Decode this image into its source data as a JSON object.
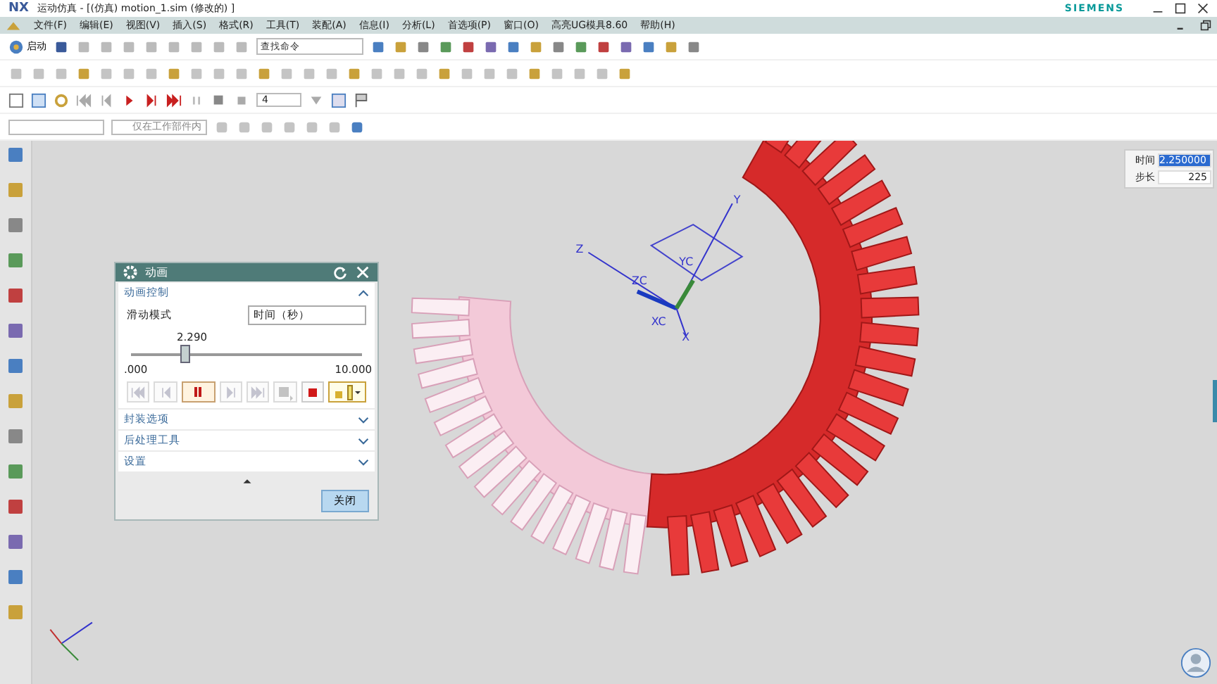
{
  "window": {
    "logo": "NX",
    "title": "运动仿真 - [(仿真) motion_1.sim  (修改的) ]",
    "brand": "SIEMENS"
  },
  "menu": [
    "文件(F)",
    "编辑(E)",
    "视图(V)",
    "插入(S)",
    "格式(R)",
    "工具(T)",
    "装配(A)",
    "信息(I)",
    "分析(L)",
    "首选项(P)",
    "窗口(O)",
    "高亮UG模具8.60",
    "帮助(H)"
  ],
  "toolbar": {
    "start_label": "启动",
    "search_placeholder": "查找命令",
    "step_value": "4",
    "scope_value": "仅在工作部件内"
  },
  "dialog": {
    "title": "动画",
    "mode_label": "滑动模式",
    "mode_value": "时间（秒）",
    "slider": {
      "reading": "2.290",
      "level": 0.229,
      "min": ".000",
      "max": "10.000"
    },
    "playback": [
      {
        "kind": "first",
        "disabled": true,
        "selected": false
      },
      {
        "kind": "prev",
        "disabled": true,
        "selected": false
      },
      {
        "kind": "pause",
        "disabled": false,
        "selected": true
      },
      {
        "kind": "next",
        "disabled": true,
        "selected": false
      },
      {
        "kind": "last",
        "disabled": true,
        "selected": false
      },
      {
        "kind": "export",
        "disabled": true,
        "selected": false
      },
      {
        "kind": "stop",
        "disabled": false,
        "selected": false
      },
      {
        "kind": "trace",
        "disabled": false,
        "selected": false
      }
    ],
    "sections": [
      {
        "label": "动画控制",
        "expanded": true
      },
      {
        "label": "封装选项",
        "expanded": false
      },
      {
        "label": "后处理工具",
        "expanded": false
      },
      {
        "label": "设置",
        "expanded": false
      }
    ],
    "close_button": "关闭"
  },
  "time_panel": [
    {
      "label": "时间",
      "value": "2.250000",
      "selected": true
    },
    {
      "label": "步长",
      "value": "225",
      "selected": false
    }
  ],
  "triad": [
    "Z",
    "ZC",
    "YC",
    "Y",
    "XC",
    "X"
  ]
}
